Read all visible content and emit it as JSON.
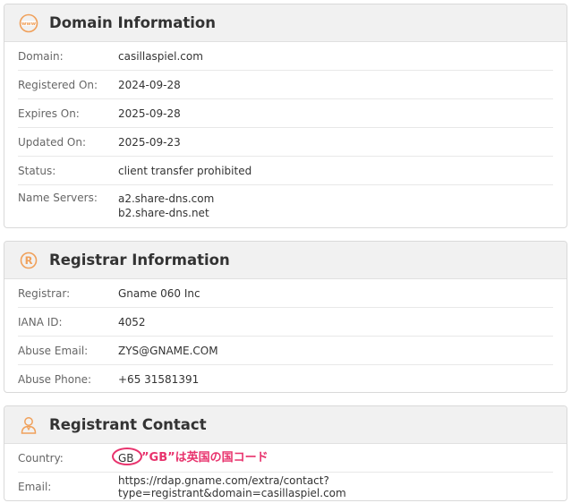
{
  "domain_info": {
    "title": "Domain Information",
    "rows": [
      {
        "label": "Domain:",
        "value": "casillaspiel.com"
      },
      {
        "label": "Registered On:",
        "value": "2024-09-28"
      },
      {
        "label": "Expires On:",
        "value": "2025-09-28"
      },
      {
        "label": "Updated On:",
        "value": "2025-09-23"
      },
      {
        "label": "Status:",
        "value": "client transfer prohibited"
      }
    ],
    "name_servers": {
      "label": "Name Servers:",
      "values": [
        "a2.share-dns.com",
        "b2.share-dns.net"
      ]
    }
  },
  "registrar_info": {
    "title": "Registrar Information",
    "rows": [
      {
        "label": "Registrar:",
        "value": "Gname 060 Inc"
      },
      {
        "label": "IANA ID:",
        "value": "4052"
      },
      {
        "label": "Abuse Email:",
        "value": "ZYS@GNAME.COM"
      },
      {
        "label": "Abuse Phone:",
        "value": "+65 31581391"
      }
    ]
  },
  "registrant_contact": {
    "title": "Registrant Contact",
    "rows": [
      {
        "label": "Country:",
        "value": "GB"
      },
      {
        "label": "Email:",
        "value": "https://rdap.gname.com/extra/contact?type=registrant&domain=casillaspiel.com"
      }
    ]
  },
  "annotation": {
    "text": "”GB”は英国の国コード"
  },
  "colors": {
    "accent": "#f0a05a",
    "annotation": "#e8336d"
  },
  "icons": {
    "domain": "www-globe-icon",
    "registrar": "registered-icon",
    "registrant": "person-icon"
  }
}
